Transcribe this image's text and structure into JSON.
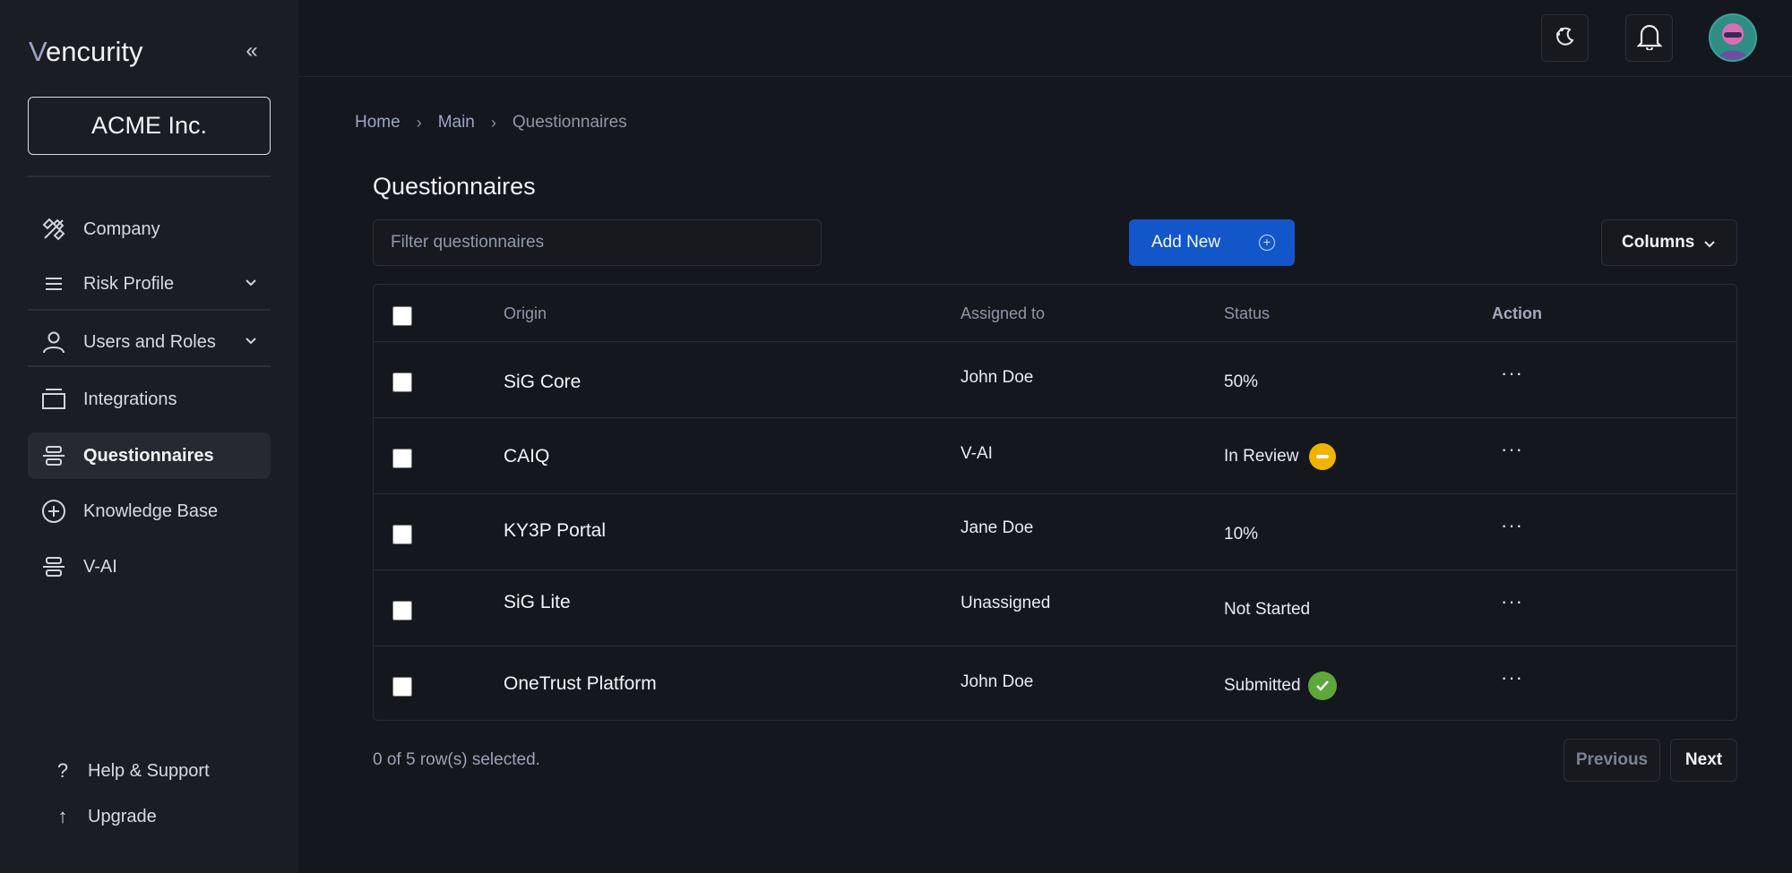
{
  "sidebar": {
    "brand_initial": "V",
    "brand_rest": "encurity",
    "org_name": "ACME Inc.",
    "items": [
      {
        "label": "Company",
        "icon": "company-icon"
      },
      {
        "label": "Risk Profile",
        "icon": "menu-icon"
      },
      {
        "label": "Users and Roles",
        "icon": "user-icon"
      },
      {
        "label": "Integrations",
        "icon": "integrations-icon"
      },
      {
        "label": "Questionnaires",
        "icon": "questionnaires-icon",
        "active": true
      },
      {
        "label": "Knowledge Base",
        "icon": "plus-circle-icon"
      },
      {
        "label": "V-AI",
        "icon": "vai-icon"
      }
    ],
    "bottom": [
      {
        "label": "Help & Support",
        "icon": "question-icon"
      },
      {
        "label": "Upgrade",
        "icon": "arrow-up-icon"
      }
    ]
  },
  "breadcrumb": [
    "Home",
    "Main",
    "Questionnaires"
  ],
  "page_title": "Questionnaires",
  "filter": {
    "placeholder": "Filter questionnaires",
    "value": ""
  },
  "add_new_label": "Add New",
  "columns_label": "Columns",
  "table": {
    "headers": {
      "origin": "Origin",
      "assigned": "Assigned to",
      "status": "Status",
      "action": "Action"
    },
    "rows": [
      {
        "origin": "SiG Core",
        "assigned": "John Doe",
        "status": "50%",
        "action": "···"
      },
      {
        "origin": "CAIQ",
        "assigned": "V-AI",
        "status": "In Review",
        "action": "···"
      },
      {
        "origin": "KY3P Portal",
        "assigned": "Jane Doe",
        "status": "10%",
        "action": "···"
      },
      {
        "origin": "SiG Lite",
        "assigned": "Unassigned",
        "status": "Not Started",
        "action": "···"
      },
      {
        "origin": "OneTrust Platform",
        "assigned": "John Doe",
        "status": "Submitted",
        "action": "···"
      }
    ]
  },
  "selection_text": "0 of 5 row(s) selected.",
  "pagination": {
    "previous": "Previous",
    "next": "Next"
  },
  "colors": {
    "accent": "#1256c9",
    "review": "#f0b400",
    "submitted": "#5ea73b"
  }
}
